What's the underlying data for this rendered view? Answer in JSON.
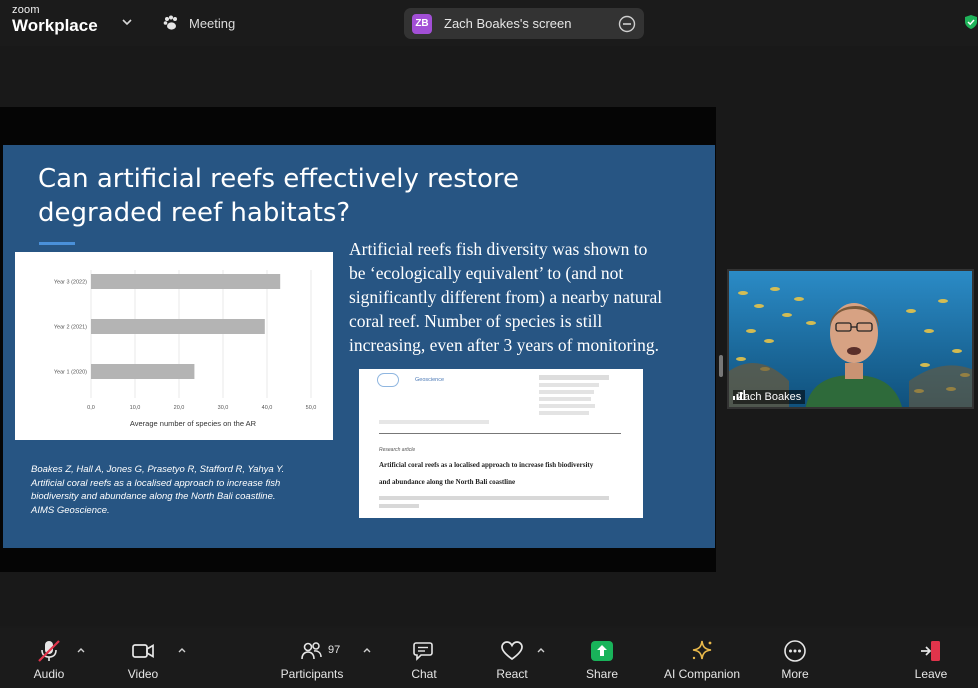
{
  "app": {
    "brand_top": "zoom",
    "brand_bottom": "Workplace",
    "meeting_label": "Meeting"
  },
  "screen_share": {
    "badge": "ZB",
    "label": "Zach Boakes's screen"
  },
  "slide": {
    "title_line1": "Can artificial reefs effectively restore",
    "title_line2": "degraded reef habitats?",
    "body_lines": [
      "Artificial reefs fish diversity was shown to",
      "be ‘ecologically equivalent’ to (and not",
      "significantly different from) a nearby natural",
      "coral reef. Number of species is still",
      "increasing, even after 3 years of monitoring."
    ],
    "citation_lines": [
      "Boakes Z, Hall A, Jones G, Prasetyo R, Stafford R, Yahya Y.",
      "Artificial coral reefs as a localised approach to increase fish",
      "biodiversity and abundance along the North Bali coastline.",
      "AIMS Geoscience."
    ],
    "paper": {
      "journal": "Geoscience",
      "title_line1": "Artificial coral reefs as a localised approach to increase fish biodiversity",
      "title_line2": "and abundance along the North Bali coastline",
      "kind": "Research article"
    }
  },
  "chart_data": {
    "type": "bar",
    "orientation": "horizontal",
    "categories": [
      "Year 3 (2022)",
      "Year 2 (2021)",
      "Year 1 (2020)"
    ],
    "values": [
      43,
      39.5,
      23.5
    ],
    "xlabel": "Average number of species on the AR",
    "xlim": [
      0,
      50
    ],
    "xticks": [
      "0,0",
      "10,0",
      "20,0",
      "30,0",
      "40,0",
      "50,0"
    ],
    "bar_color": "#b4b4b4",
    "grid": true
  },
  "participant": {
    "name": "Zach Boakes"
  },
  "toolbar": {
    "audio": "Audio",
    "video": "Video",
    "participants": "Participants",
    "participants_count": "97",
    "chat": "Chat",
    "react": "React",
    "share": "Share",
    "ai_companion": "AI Companion",
    "more": "More",
    "leave": "Leave"
  },
  "colors": {
    "slide_bg": "#275583",
    "share_green": "#19b35a",
    "ai_gold": "#e8b84a",
    "leave_red": "#e0344b",
    "zb_badge": "#a24fd6"
  }
}
